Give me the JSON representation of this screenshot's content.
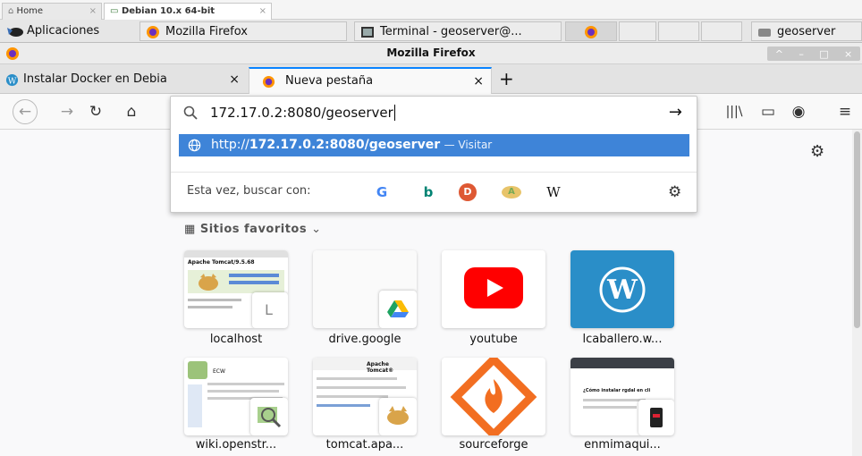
{
  "vm_tabs": [
    {
      "label": "Home",
      "close": "×"
    },
    {
      "label": "Debian 10.x 64-bit",
      "close": "×"
    }
  ],
  "panel": {
    "apps_label": "Aplicaciones",
    "windows": [
      "Mozilla Firefox",
      "Terminal - geoserver@...",
      "geoserver"
    ]
  },
  "window": {
    "title": "Mozilla Firefox",
    "controls": [
      "^",
      "–",
      "□",
      "×"
    ]
  },
  "tabs": [
    {
      "label": "Instalar Docker en Debia",
      "close": "×"
    },
    {
      "label": "Nueva pestaña",
      "close": "×"
    }
  ],
  "new_tab_symbol": "+",
  "urlbar": {
    "value": "172.17.0.2:8080/geoserver",
    "go_symbol": "→",
    "suggestion_prefix": "http://",
    "suggestion_bold": "172.17.0.2:8080/geoserver",
    "suggestion_action": "— Visitar",
    "search_label": "Esta vez, buscar con:",
    "engines": [
      "G",
      "b",
      "D",
      "A",
      "W"
    ]
  },
  "topsites": {
    "heading": "Sitios favoritos",
    "items": [
      {
        "label": "localhost",
        "thumb_title": "Apache Tomcat/9.5.68"
      },
      {
        "label": "drive.google"
      },
      {
        "label": "youtube"
      },
      {
        "label": "lcaballero.w..."
      },
      {
        "label": "wiki.openstr...",
        "thumb_title": "ECW"
      },
      {
        "label": "tomcat.apa...",
        "thumb_title": "Apache Tomcat®"
      },
      {
        "label": "sourceforge"
      },
      {
        "label": "enmimaqui...",
        "thumb_title": "¿Cómo instalar rgdal en cli"
      }
    ]
  },
  "colors": {
    "accent": "#0a84ff",
    "suggestion_bg": "#3e84d8",
    "youtube": "#ff0000",
    "wordpress": "#2a8ec8",
    "sourceforge": "#f26e21"
  }
}
